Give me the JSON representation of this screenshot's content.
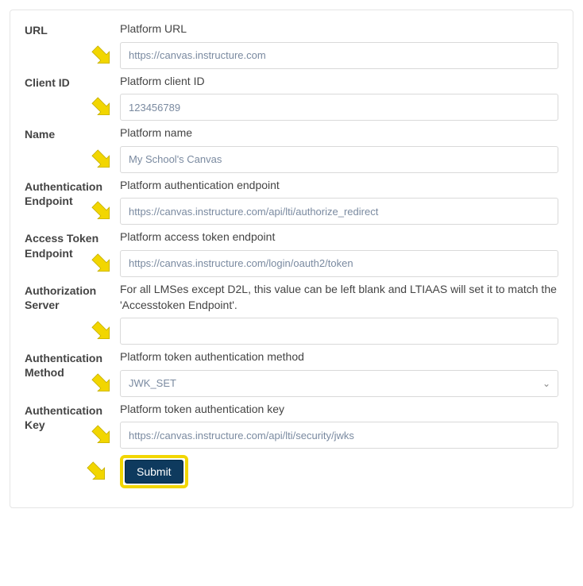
{
  "form": {
    "url": {
      "label": "URL",
      "hint": "Platform URL",
      "value": "https://canvas.instructure.com"
    },
    "client_id": {
      "label": "Client ID",
      "hint": "Platform client ID",
      "value": "123456789"
    },
    "name": {
      "label": "Name",
      "hint": "Platform name",
      "value": "My School's Canvas"
    },
    "auth_endpoint": {
      "label": "Authentication Endpoint",
      "hint": "Platform authentication endpoint",
      "value": "https://canvas.instructure.com/api/lti/authorize_redirect"
    },
    "access_token_endpoint": {
      "label": "Access Token Endpoint",
      "hint": "Platform access token endpoint",
      "value": "https://canvas.instructure.com/login/oauth2/token"
    },
    "authorization_server": {
      "label": "Authorization Server",
      "hint": "For all LMSes except D2L, this value can be left blank and LTIAAS will set it to match the 'Accesstoken Endpoint'.",
      "value": ""
    },
    "auth_method": {
      "label": "Authentication Method",
      "hint": "Platform token authentication method",
      "value": "JWK_SET"
    },
    "auth_key": {
      "label": "Authentication Key",
      "hint": "Platform token authentication key",
      "value": "https://canvas.instructure.com/api/lti/security/jwks"
    },
    "submit_label": "Submit"
  }
}
